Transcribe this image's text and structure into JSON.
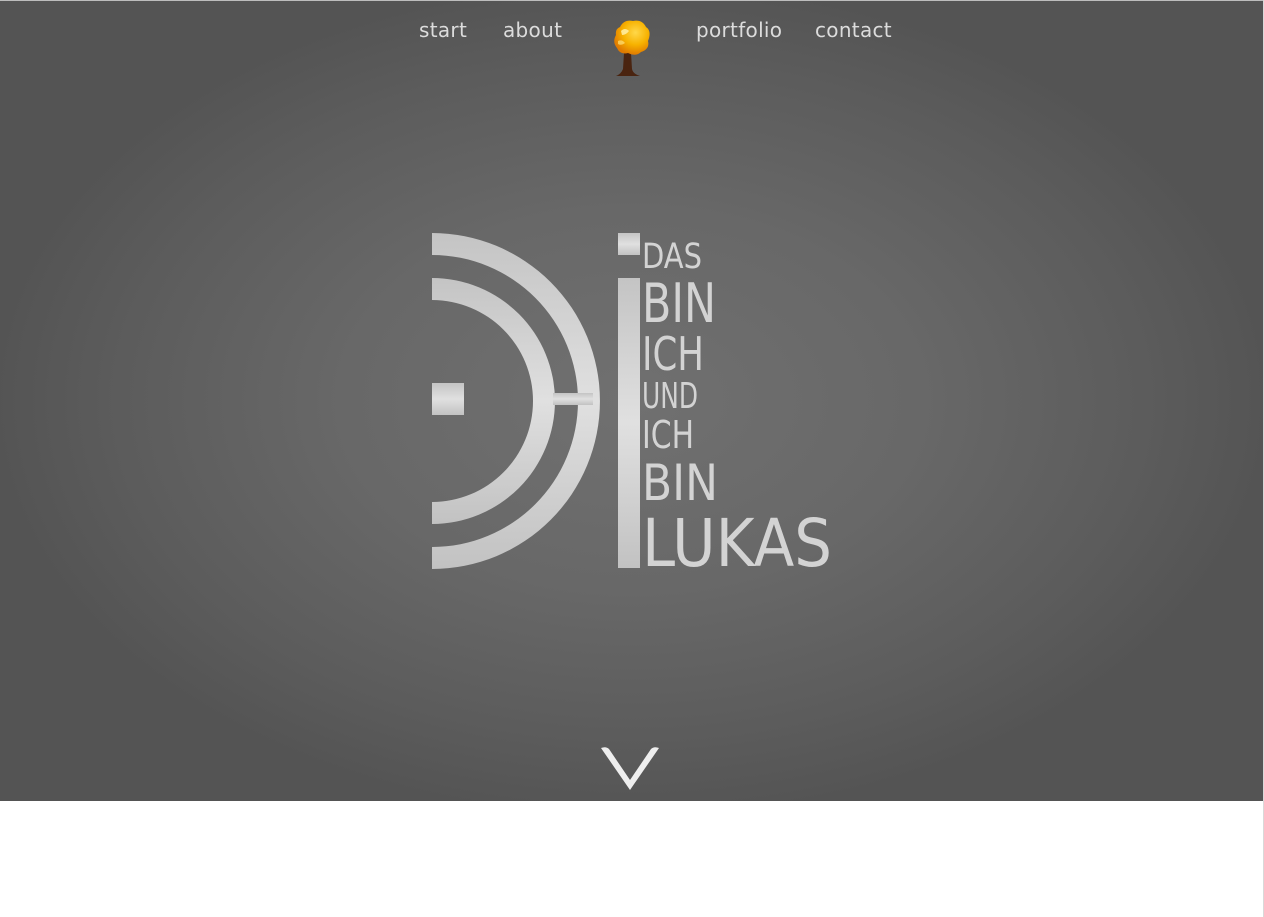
{
  "nav": {
    "start_label": "start",
    "about_label": "about",
    "portfolio_label": "portfolio",
    "contact_label": "contact"
  },
  "logo": {
    "icon": "tree-icon",
    "words": [
      "DAS",
      "BIN",
      "ICH",
      "UND",
      "ICH",
      "BIN",
      "LUKAS"
    ]
  },
  "scroll": {
    "icon": "chevron-down-icon"
  },
  "colors": {
    "hero_center": "#707070",
    "hero_edge": "#545454",
    "nav_text": "#dcdcdc",
    "logo_fill": "#d3d3d3",
    "tree_crown": "#f5b400",
    "tree_trunk": "#4a2410"
  }
}
